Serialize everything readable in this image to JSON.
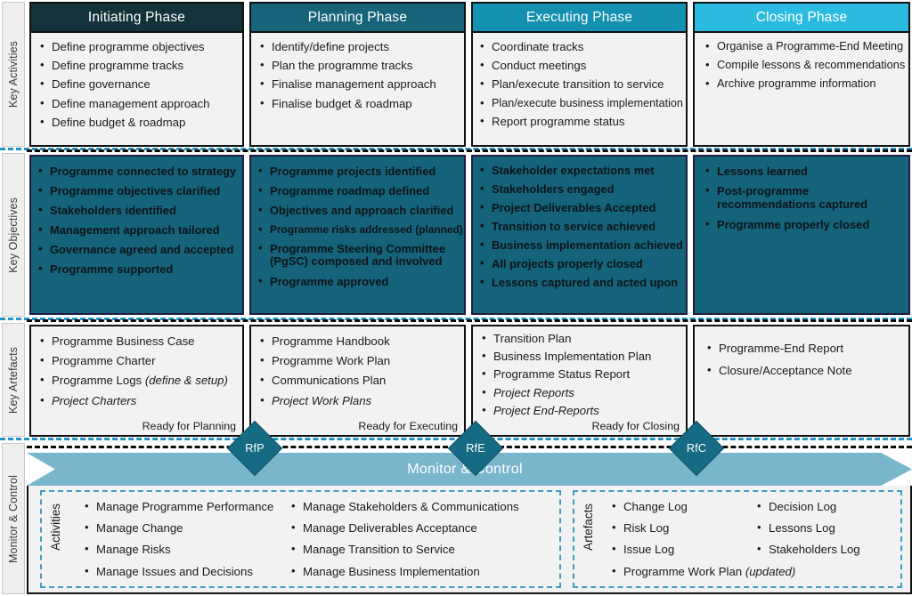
{
  "rails": [
    {
      "label": "Key Activities"
    },
    {
      "label": "Key Objectives"
    },
    {
      "label": "Key Artefacts"
    },
    {
      "label": "Monitor & Control"
    }
  ],
  "phases": [
    {
      "name": "Initiating Phase",
      "color": "#13323a"
    },
    {
      "name": "Planning Phase",
      "color": "#176379"
    },
    {
      "name": "Executing Phase",
      "color": "#1490b0"
    },
    {
      "name": "Closing Phase",
      "color": "#2cbbe0"
    }
  ],
  "key_activities": {
    "initiating": [
      "Define programme objectives",
      "Define programme tracks",
      "Define governance",
      "Define management approach",
      "Define budget & roadmap"
    ],
    "planning": [
      "Identify/define projects",
      "Plan the programme tracks",
      "Finalise management approach",
      "Finalise budget & roadmap"
    ],
    "executing": [
      "Coordinate tracks",
      "Conduct meetings",
      "Plan/execute transition to service",
      "Plan/execute business implementation",
      "Report programme status"
    ],
    "closing": [
      "Organise a Programme-End Meeting",
      "Compile lessons & recommendations",
      "Archive programme information"
    ]
  },
  "key_objectives": {
    "initiating": [
      "Programme connected to strategy",
      "Programme objectives clarified",
      "Stakeholders identified",
      "Management approach tailored",
      "Governance agreed and accepted",
      "Programme supported"
    ],
    "planning": [
      "Programme projects identified",
      "Programme roadmap defined",
      "Objectives and approach clarified",
      "Programme risks addressed (planned)",
      "Programme Steering Committee (PgSC) composed and involved",
      "Programme approved"
    ],
    "executing": [
      "Stakeholder expectations met",
      "Stakeholders engaged",
      "Project Deliverables Accepted",
      "Transition to service achieved",
      "Business implementation achieved",
      "All projects properly closed",
      "Lessons captured and acted upon"
    ],
    "closing": [
      "Lessons learned",
      "Post-programme recommendations captured",
      "Programme properly closed"
    ]
  },
  "key_artefacts": {
    "initiating": {
      "items": [
        {
          "text": "Programme Business Case",
          "style": "normal"
        },
        {
          "text": "Programme Charter",
          "style": "normal"
        },
        {
          "text": "Programme Logs ",
          "suffix": "(define & setup)",
          "style": "mixed"
        },
        {
          "text": "Project Charters",
          "style": "project"
        }
      ],
      "ready": "Ready for Planning"
    },
    "planning": {
      "items": [
        {
          "text": "Programme Handbook",
          "style": "normal"
        },
        {
          "text": "Programme Work Plan",
          "style": "normal"
        },
        {
          "text": "Communications Plan",
          "style": "normal"
        },
        {
          "text": "Project Work Plans",
          "style": "project"
        }
      ],
      "ready": "Ready for Executing"
    },
    "executing": {
      "items": [
        {
          "text": "Transition Plan",
          "style": "normal"
        },
        {
          "text": "Business Implementation Plan",
          "style": "normal"
        },
        {
          "text": "Programme Status Report",
          "style": "normal"
        },
        {
          "text": "Project Reports",
          "style": "project"
        },
        {
          "text": "Project End-Reports",
          "style": "project"
        }
      ],
      "ready": "Ready for Closing"
    },
    "closing": {
      "items": [
        {
          "text": "Programme-End Report",
          "style": "normal"
        },
        {
          "text": "Closure/Acceptance Note",
          "style": "normal"
        }
      ],
      "ready": ""
    }
  },
  "gates": [
    {
      "label": "RfP"
    },
    {
      "label": "RfE"
    },
    {
      "label": "RfC"
    }
  ],
  "monitor_control": {
    "banner_title": "Monitor & Control",
    "banner_color": "#79b6cc",
    "activities": {
      "label": "Activities",
      "column1": [
        "Manage Programme Performance",
        "Manage Change",
        "Manage Risks",
        "Manage Issues and Decisions"
      ],
      "column2": [
        "Manage Stakeholders & Communications",
        "Manage Deliverables Acceptance",
        "Manage Transition to Service",
        "Manage Business Implementation"
      ]
    },
    "artefacts": {
      "label": "Artefacts",
      "column1": [
        {
          "text": "Change Log",
          "style": "normal"
        },
        {
          "text": "Risk Log",
          "style": "normal"
        },
        {
          "text": " Issue Log",
          "style": "normal"
        },
        {
          "text": "Programme Work Plan ",
          "suffix": "(updated)",
          "style": "mixed"
        }
      ],
      "column2": [
        {
          "text": "Decision Log",
          "style": "normal"
        },
        {
          "text": "Lessons Log",
          "style": "normal"
        },
        {
          "text": "Stakeholders Log",
          "style": "normal"
        }
      ]
    }
  }
}
